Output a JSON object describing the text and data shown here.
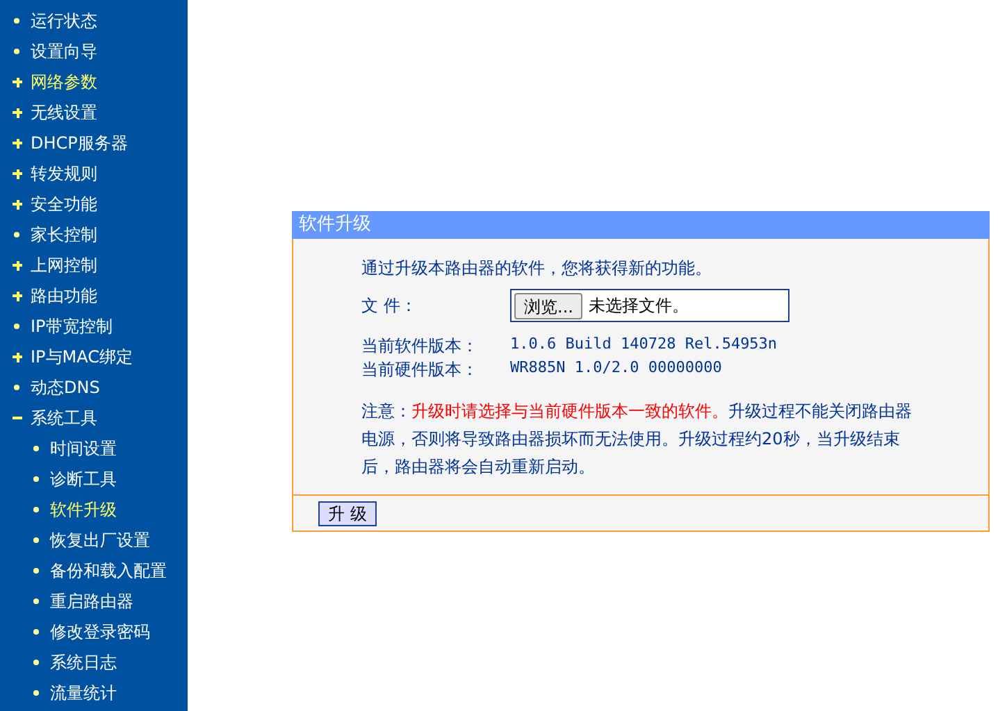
{
  "sidebar": {
    "items": [
      {
        "label": "运行状态",
        "kind": "leaf",
        "selected": false
      },
      {
        "label": "设置向导",
        "kind": "leaf",
        "selected": false
      },
      {
        "label": "网络参数",
        "kind": "group",
        "expanded": false,
        "selected": true
      },
      {
        "label": "无线设置",
        "kind": "group",
        "expanded": false,
        "selected": false
      },
      {
        "label": "DHCP服务器",
        "kind": "group",
        "expanded": false,
        "selected": false
      },
      {
        "label": "转发规则",
        "kind": "group",
        "expanded": false,
        "selected": false
      },
      {
        "label": "安全功能",
        "kind": "group",
        "expanded": false,
        "selected": false
      },
      {
        "label": "家长控制",
        "kind": "leaf",
        "selected": false
      },
      {
        "label": "上网控制",
        "kind": "group",
        "expanded": false,
        "selected": false
      },
      {
        "label": "路由功能",
        "kind": "group",
        "expanded": false,
        "selected": false
      },
      {
        "label": "IP带宽控制",
        "kind": "leaf",
        "selected": false
      },
      {
        "label": "IP与MAC绑定",
        "kind": "group",
        "expanded": false,
        "selected": false
      },
      {
        "label": "动态DNS",
        "kind": "leaf",
        "selected": false
      },
      {
        "label": "系统工具",
        "kind": "group",
        "expanded": true,
        "selected": false,
        "children": [
          {
            "label": "时间设置",
            "kind": "leaf",
            "selected": false
          },
          {
            "label": "诊断工具",
            "kind": "leaf",
            "selected": false
          },
          {
            "label": "软件升级",
            "kind": "leaf",
            "selected": true
          },
          {
            "label": "恢复出厂设置",
            "kind": "leaf",
            "selected": false
          },
          {
            "label": "备份和载入配置",
            "kind": "leaf",
            "selected": false
          },
          {
            "label": "重启路由器",
            "kind": "leaf",
            "selected": false
          },
          {
            "label": "修改登录密码",
            "kind": "leaf",
            "selected": false
          },
          {
            "label": "系统日志",
            "kind": "leaf",
            "selected": false
          },
          {
            "label": "流量统计",
            "kind": "leaf",
            "selected": false
          }
        ]
      }
    ]
  },
  "panel": {
    "title": "软件升级",
    "intro": "通过升级本路由器的软件，您将获得新的功能。",
    "file": {
      "label": "文 件：",
      "browse_button": "浏览...",
      "value": "未选择文件。"
    },
    "versions": [
      {
        "label": "当前软件版本：",
        "value": "1.0.6 Build 140728 Rel.54953n"
      },
      {
        "label": "当前硬件版本：",
        "value": "WR885N 1.0/2.0 00000000"
      }
    ],
    "note": [
      {
        "text": "注意：",
        "warning": false
      },
      {
        "text": "升级时请选择与当前硬件版本一致的软件。",
        "warning": true
      },
      {
        "text": "升级过程不能关闭路由器电源，否则将导致路由器损坏而无法使用。升级过程约20秒，当升级结束后，路由器将会自动重新启动。",
        "warning": false
      }
    ],
    "upgrade_button": "升 级"
  }
}
